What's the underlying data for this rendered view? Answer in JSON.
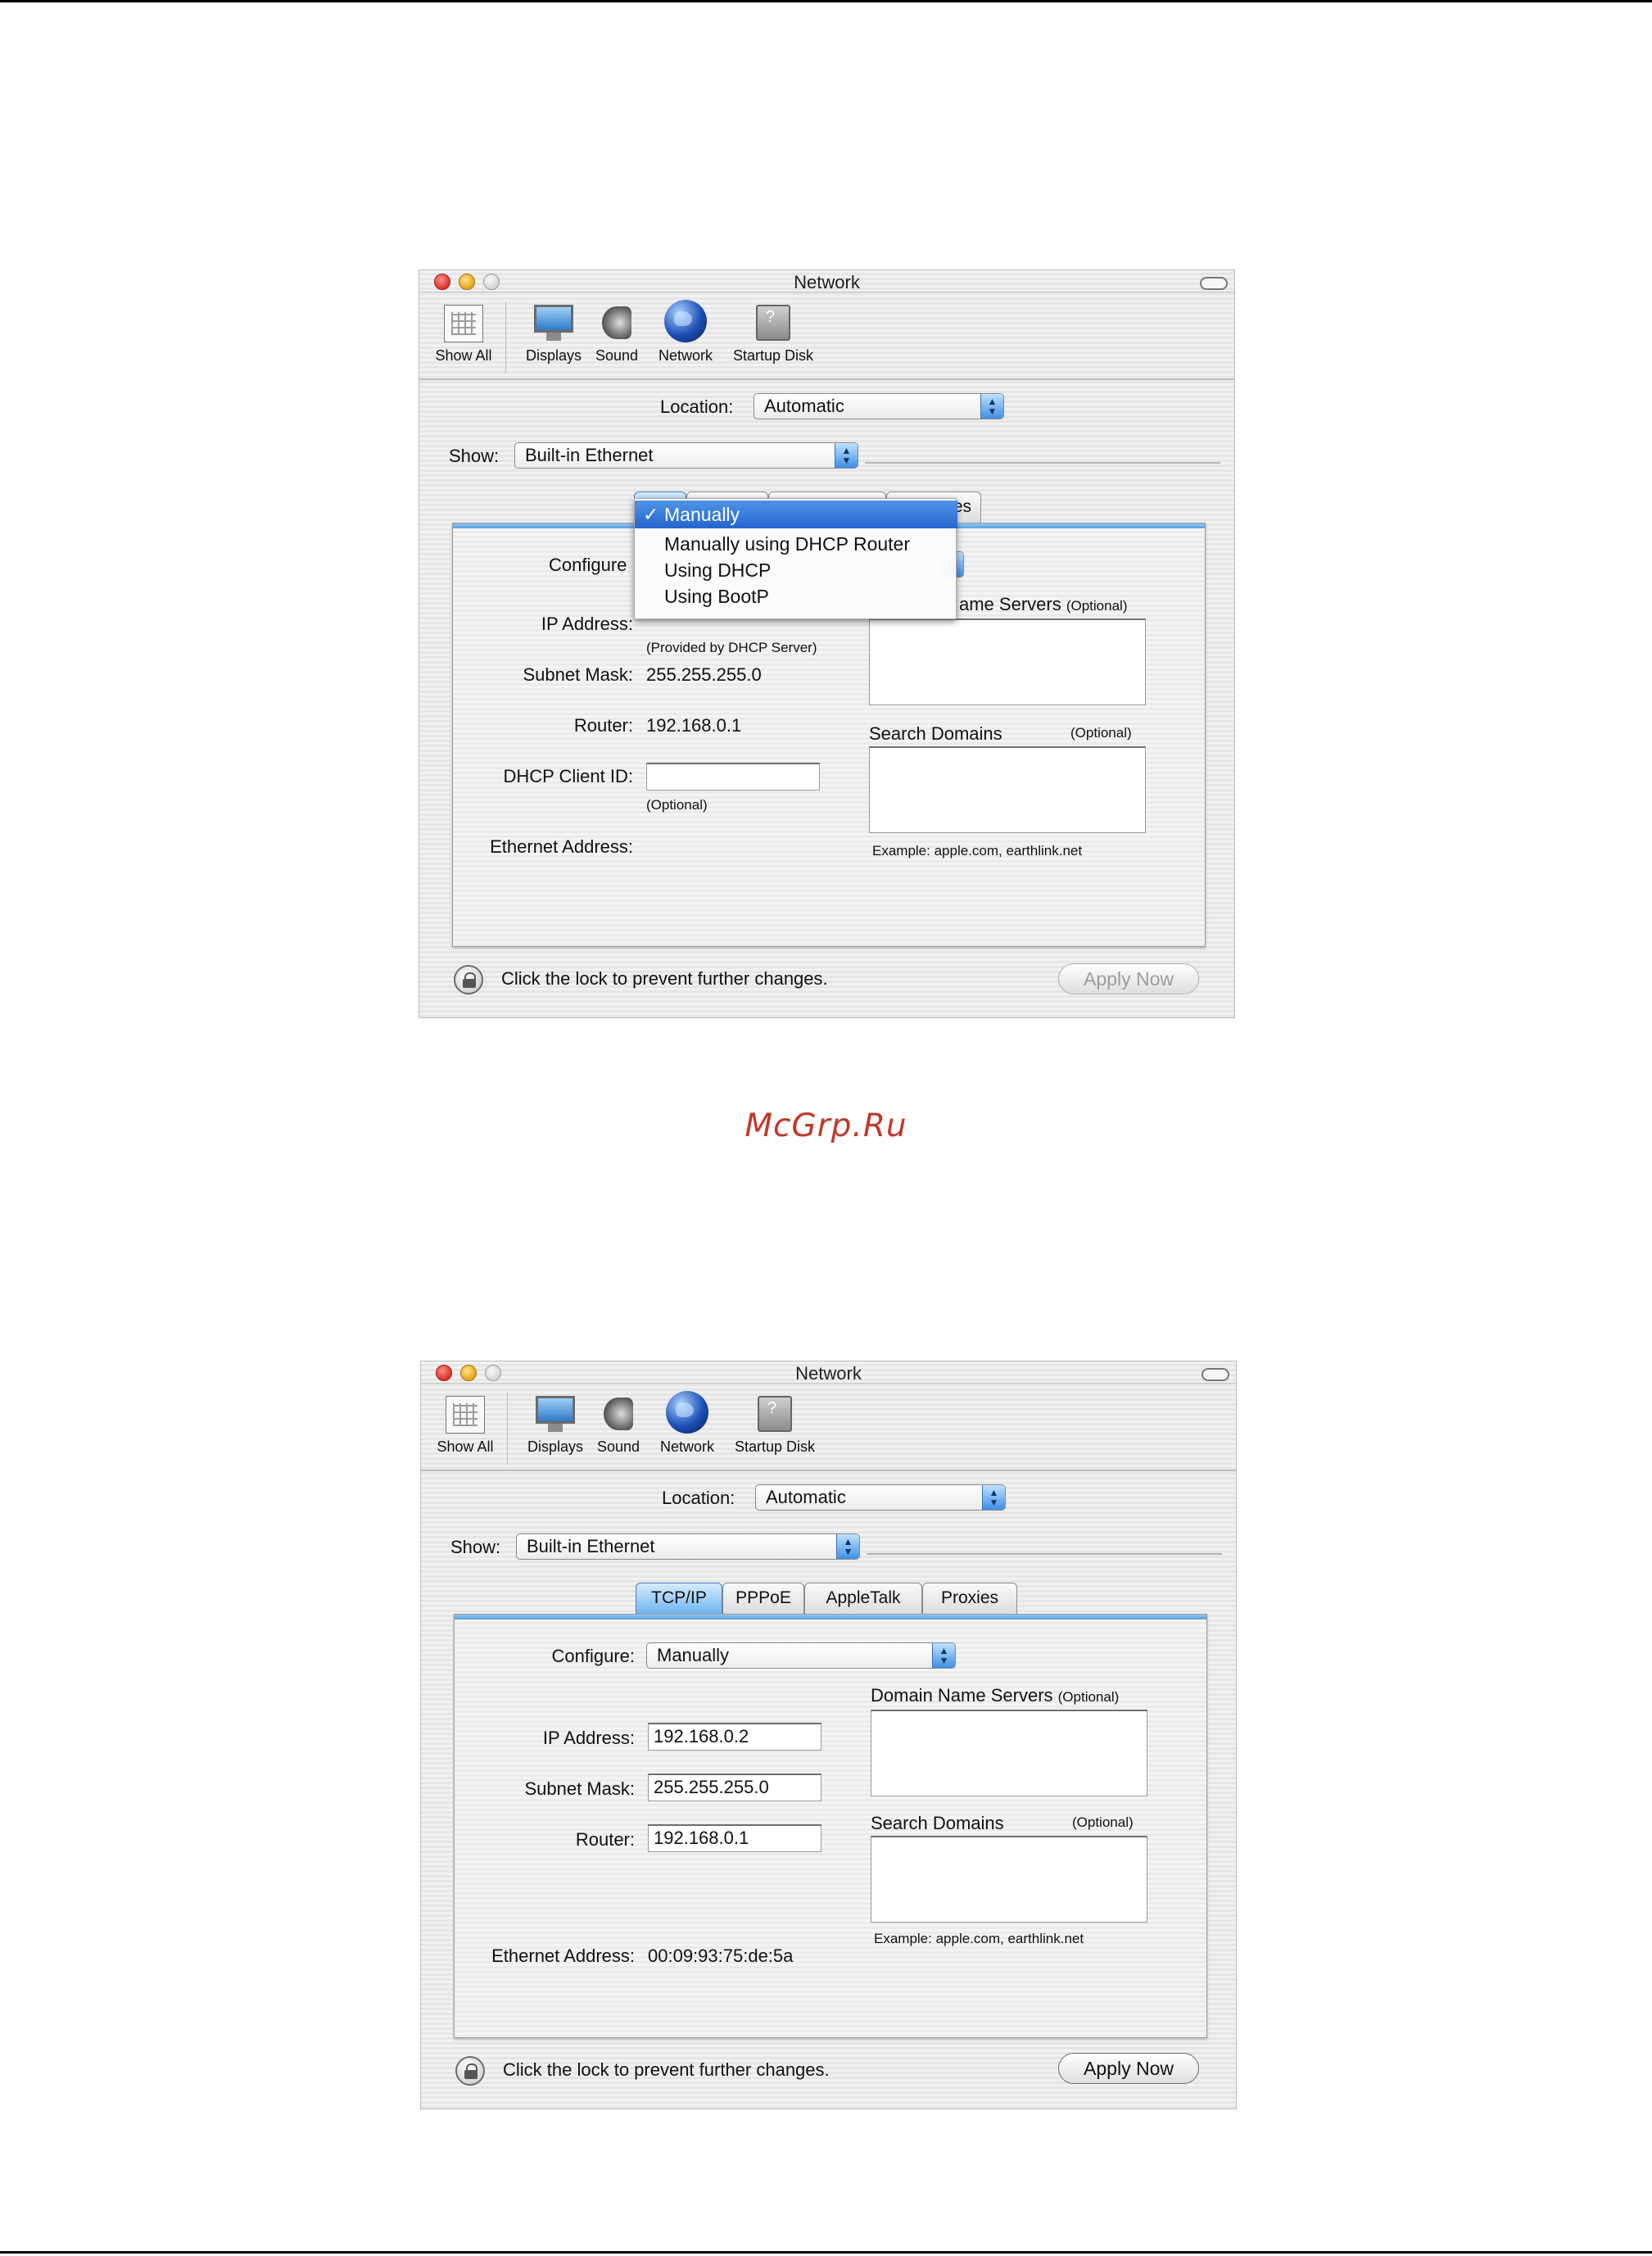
{
  "watermark": "McGrp.Ru",
  "toolbar_items": [
    "Show All",
    "Displays",
    "Sound",
    "Network",
    "Startup Disk"
  ],
  "window1": {
    "title": "Network",
    "location_label": "Location:",
    "location_value": "Automatic",
    "show_label": "Show:",
    "show_value": "Built-in Ethernet",
    "tab_visible_fragment": "roxies",
    "configure_label": "Configure",
    "configure_menu": {
      "selected_mark": "✓",
      "items": [
        "Manually",
        "Manually using DHCP Router",
        "Using DHCP",
        "Using BootP"
      ]
    },
    "dns_label": "Domain Name Servers",
    "dns_fragment": "ame Servers",
    "optional": "(Optional)",
    "ip_label": "IP Address:",
    "ip_note": "(Provided by DHCP Server)",
    "subnet_label": "Subnet Mask:",
    "subnet_value": "255.255.255.0",
    "router_label": "Router:",
    "router_value": "192.168.0.1",
    "search_domains_label": "Search Domains",
    "dhcp_client_label": "DHCP Client ID:",
    "dhcp_client_value": "",
    "dhcp_client_note": "(Optional)",
    "example": "Example: apple.com, earthlink.net",
    "ethernet_label": "Ethernet Address:",
    "lock_text": "Click the lock to prevent further changes.",
    "apply": "Apply Now"
  },
  "window2": {
    "title": "Network",
    "location_label": "Location:",
    "location_value": "Automatic",
    "show_label": "Show:",
    "show_value": "Built-in Ethernet",
    "tabs": [
      "TCP/IP",
      "PPPoE",
      "AppleTalk",
      "Proxies"
    ],
    "configure_label": "Configure:",
    "configure_value": "Manually",
    "dns_label": "Domain Name Servers",
    "optional": "(Optional)",
    "ip_label": "IP Address:",
    "ip_value": "192.168.0.2",
    "subnet_label": "Subnet Mask:",
    "subnet_value": "255.255.255.0",
    "router_label": "Router:",
    "router_value": "192.168.0.1",
    "search_domains_label": "Search Domains",
    "example": "Example: apple.com, earthlink.net",
    "ethernet_label": "Ethernet Address:",
    "ethernet_value": "00:09:93:75:de:5a",
    "lock_text": "Click the lock to prevent further changes.",
    "apply": "Apply Now"
  },
  "colors": {
    "accent_blue": "#3f8ee6",
    "menu_highlight": "#2565cf",
    "watermark_red": "#c0392b",
    "close_red": "#d9302a",
    "minimize_yellow": "#e8a317"
  },
  "icons": [
    "show-all-icon",
    "displays-icon",
    "sound-icon",
    "network-icon",
    "startup-disk-icon",
    "lock-icon",
    "popup-arrows-icon",
    "checkmark-icon"
  ]
}
